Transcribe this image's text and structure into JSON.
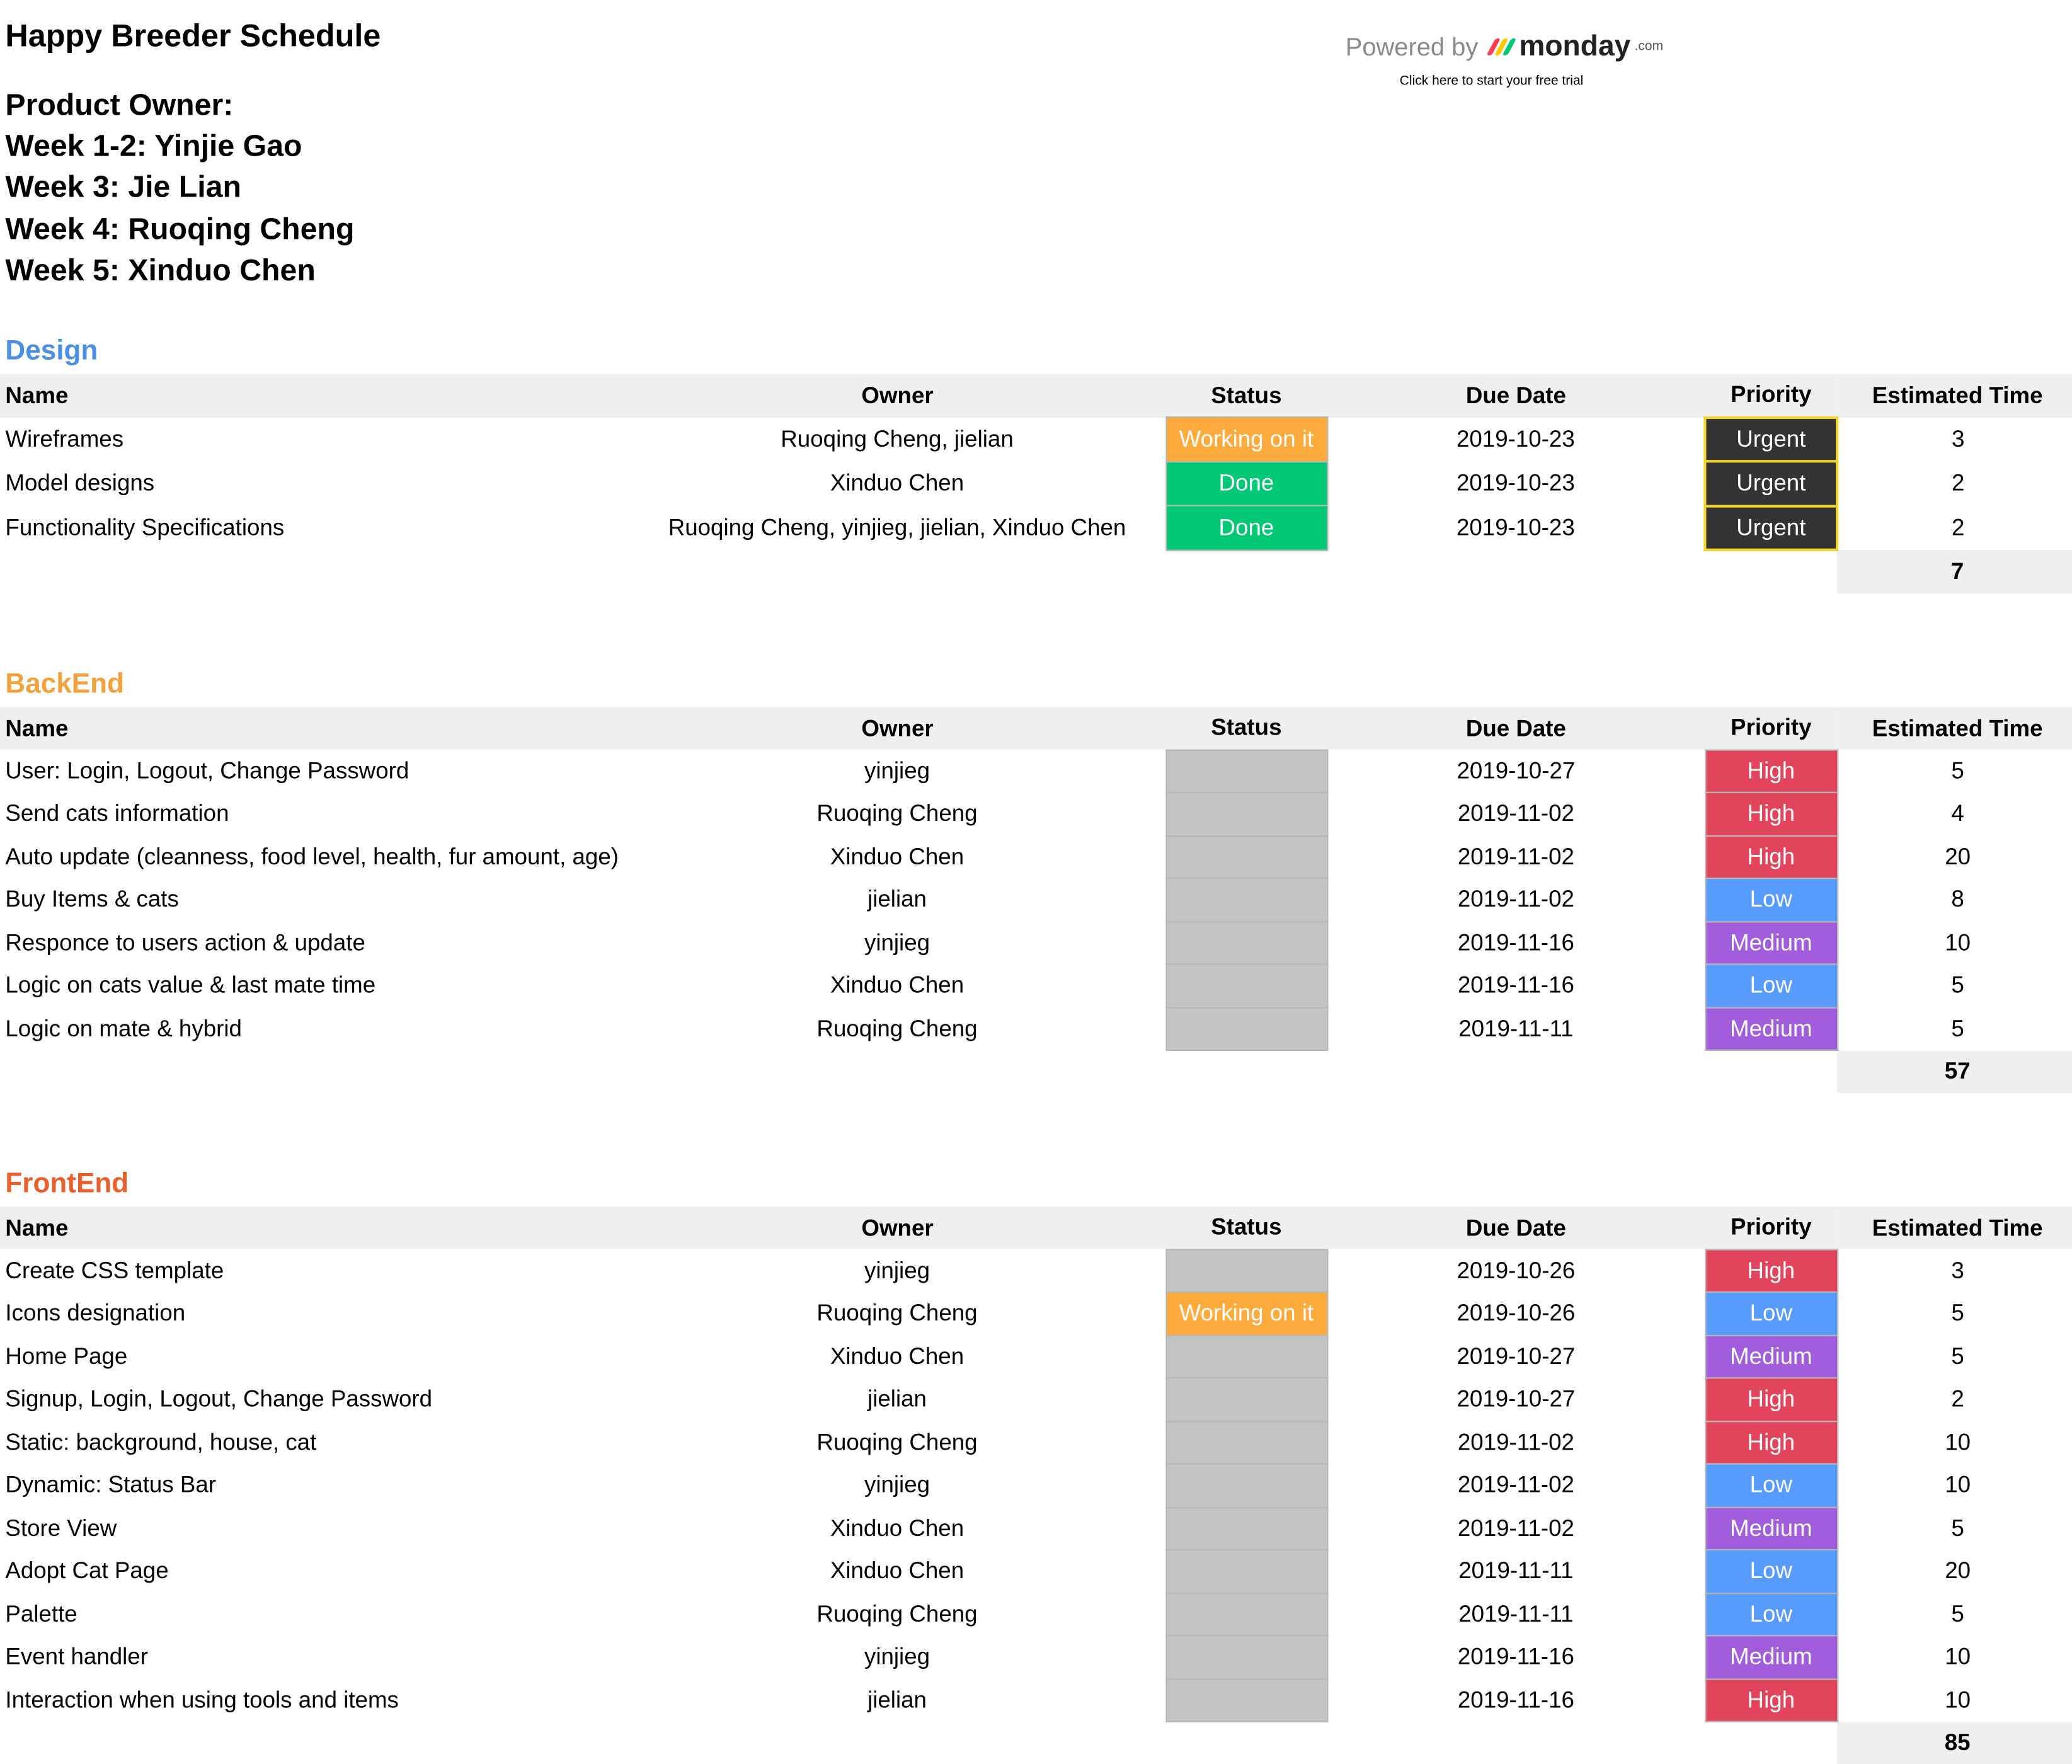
{
  "page": {
    "title": "Happy Breeder Schedule",
    "product_owner_lines": [
      "Product Owner:",
      "Week 1-2: Yinjie Gao",
      "Week 3: Jie Lian",
      "Week 4: Ruoqing Cheng",
      "Week 5: Xinduo Chen"
    ]
  },
  "branding": {
    "powered_by": "Powered by",
    "logo_name": "monday",
    "logo_suffix": ".com",
    "trial_text": "Click here to start your free trial",
    "logo_bar_colors": [
      "#ff3d57",
      "#ffcb00",
      "#00ca72"
    ]
  },
  "columns": [
    "Name",
    "Owner",
    "Status",
    "Due Date",
    "Priority",
    "Estimated Time"
  ],
  "colors": {
    "status": {
      "Working on it": "#fdab3d",
      "Done": "#00c875",
      "": "#c4c4c4"
    },
    "priority": {
      "Urgent": "#333333",
      "High": "#e2445c",
      "Low": "#579bfc",
      "Medium": "#a25ddc"
    }
  },
  "sections": [
    {
      "title": "Design",
      "title_color": "#4a8fe0",
      "rows": [
        {
          "name": "Wireframes",
          "owner": "Ruoqing Cheng, jielian",
          "status": "Working on it",
          "due": "2019-10-23",
          "priority": "Urgent",
          "est": "3"
        },
        {
          "name": "Model designs",
          "owner": "Xinduo Chen",
          "status": "Done",
          "due": "2019-10-23",
          "priority": "Urgent",
          "est": "2"
        },
        {
          "name": "Functionality Specifications",
          "owner": "Ruoqing Cheng, yinjieg, jielian, Xinduo Chen",
          "status": "Done",
          "due": "2019-10-23",
          "priority": "Urgent",
          "est": "2"
        }
      ],
      "total": "7"
    },
    {
      "title": "BackEnd",
      "title_color": "#f2a23c",
      "rows": [
        {
          "name": "User: Login, Logout, Change Password",
          "owner": "yinjieg",
          "status": "",
          "due": "2019-10-27",
          "priority": "High",
          "est": "5"
        },
        {
          "name": "Send cats information",
          "owner": "Ruoqing Cheng",
          "status": "",
          "due": "2019-11-02",
          "priority": "High",
          "est": "4"
        },
        {
          "name": "Auto update (cleanness, food level, health, fur amount, age)",
          "owner": "Xinduo Chen",
          "status": "",
          "due": "2019-11-02",
          "priority": "High",
          "est": "20"
        },
        {
          "name": "Buy Items & cats",
          "owner": "jielian",
          "status": "",
          "due": "2019-11-02",
          "priority": "Low",
          "est": "8"
        },
        {
          "name": "Responce to users action & update",
          "owner": "yinjieg",
          "status": "",
          "due": "2019-11-16",
          "priority": "Medium",
          "est": "10"
        },
        {
          "name": "Logic on cats value & last mate time",
          "owner": "Xinduo Chen",
          "status": "",
          "due": "2019-11-16",
          "priority": "Low",
          "est": "5"
        },
        {
          "name": "Logic on mate & hybrid",
          "owner": "Ruoqing Cheng",
          "status": "",
          "due": "2019-11-11",
          "priority": "Medium",
          "est": "5"
        }
      ],
      "total": "57"
    },
    {
      "title": "FrontEnd",
      "title_color": "#e8602c",
      "rows": [
        {
          "name": "Create CSS template",
          "owner": "yinjieg",
          "status": "",
          "due": "2019-10-26",
          "priority": "High",
          "est": "3"
        },
        {
          "name": "Icons designation",
          "owner": "Ruoqing Cheng",
          "status": "Working on it",
          "due": "2019-10-26",
          "priority": "Low",
          "est": "5"
        },
        {
          "name": "Home Page",
          "owner": "Xinduo Chen",
          "status": "",
          "due": "2019-10-27",
          "priority": "Medium",
          "est": "5"
        },
        {
          "name": "Signup, Login, Logout, Change Password",
          "owner": "jielian",
          "status": "",
          "due": "2019-10-27",
          "priority": "High",
          "est": "2"
        },
        {
          "name": "Static: background, house, cat",
          "owner": "Ruoqing Cheng",
          "status": "",
          "due": "2019-11-02",
          "priority": "High",
          "est": "10"
        },
        {
          "name": "Dynamic: Status Bar",
          "owner": "yinjieg",
          "status": "",
          "due": "2019-11-02",
          "priority": "Low",
          "est": "10"
        },
        {
          "name": "Store View",
          "owner": "Xinduo Chen",
          "status": "",
          "due": "2019-11-02",
          "priority": "Medium",
          "est": "5"
        },
        {
          "name": "Adopt Cat Page",
          "owner": "Xinduo Chen",
          "status": "",
          "due": "2019-11-11",
          "priority": "Low",
          "est": "20"
        },
        {
          "name": "Palette",
          "owner": "Ruoqing Cheng",
          "status": "",
          "due": "2019-11-11",
          "priority": "Low",
          "est": "5"
        },
        {
          "name": "Event handler",
          "owner": "yinjieg",
          "status": "",
          "due": "2019-11-16",
          "priority": "Medium",
          "est": "10"
        },
        {
          "name": "Interaction when using tools and items",
          "owner": "jielian",
          "status": "",
          "due": "2019-11-16",
          "priority": "High",
          "est": "10"
        }
      ],
      "total": "85"
    }
  ]
}
